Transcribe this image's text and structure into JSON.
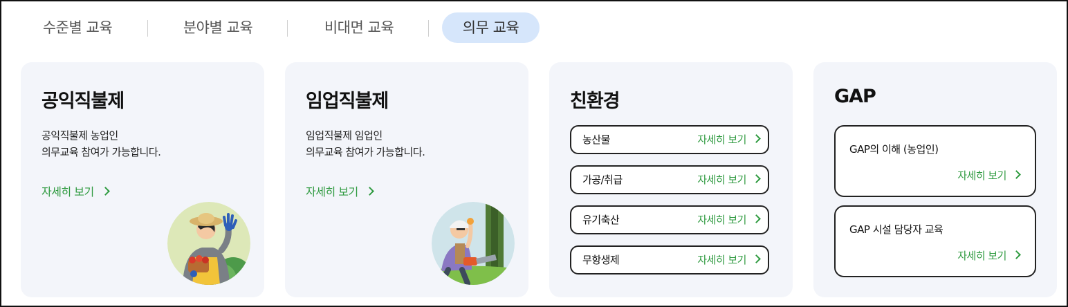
{
  "tabs": [
    {
      "label": "수준별 교육",
      "active": false
    },
    {
      "label": "분야별 교육",
      "active": false
    },
    {
      "label": "비대면 교육",
      "active": false
    },
    {
      "label": "의무 교육",
      "active": true
    }
  ],
  "colors": {
    "accent_green": "#2e9a3f",
    "active_tab_bg": "#d6e6fb",
    "card_bg": "#f3f5fa"
  },
  "cards": {
    "public": {
      "title": "공익직불제",
      "desc_line1": "공익직불제 농업인",
      "desc_line2": "의무교육 참여가 가능합니다.",
      "link": "자세히 보기"
    },
    "forestry": {
      "title": "임업직불제",
      "desc_line1": "임업직불제 임업인",
      "desc_line2": "의무교육 참여가 가능합니다.",
      "link": "자세히 보기"
    },
    "eco": {
      "title": "친환경",
      "items": [
        {
          "label": "농산물",
          "link": "자세히 보기"
        },
        {
          "label": "가공/취급",
          "link": "자세히 보기"
        },
        {
          "label": "유기축산",
          "link": "자세히 보기"
        },
        {
          "label": "무항생제",
          "link": "자세히 보기"
        }
      ]
    },
    "gap": {
      "title": "GAP",
      "items": [
        {
          "label": "GAP의 이해 (농업인)",
          "link": "자세히 보기"
        },
        {
          "label": "GAP 시설 담당자 교육",
          "link": "자세히 보기"
        }
      ]
    }
  },
  "icons": {
    "chevron": "chevron-right-icon",
    "farmer": "farmer-illustration",
    "forester": "forester-illustration"
  }
}
